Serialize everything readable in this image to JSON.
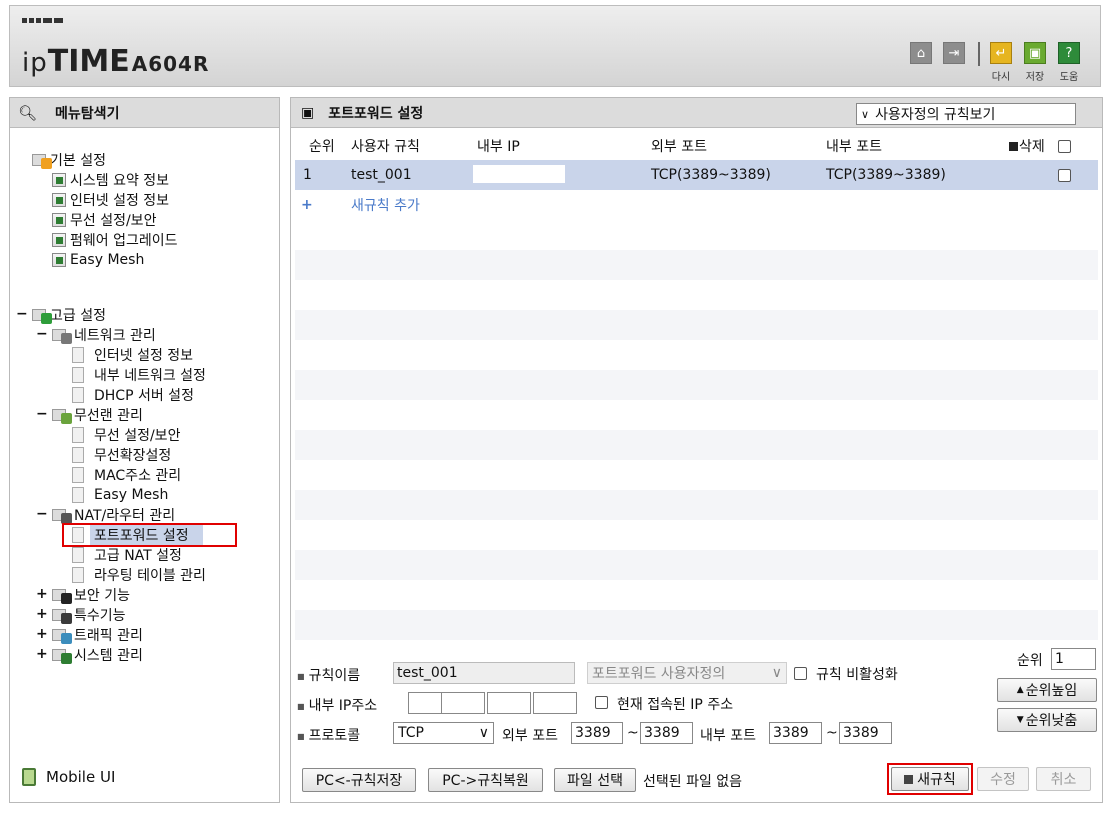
{
  "header": {
    "logo_ip": "ip",
    "logo_time": "TIME",
    "logo_model": "A604R",
    "buttons": [
      {
        "icon": "home-icon"
      },
      {
        "icon": "logout-icon"
      },
      {
        "icon": "refresh-icon",
        "label": "다시"
      },
      {
        "icon": "save-icon",
        "label": "저장"
      },
      {
        "icon": "help-icon",
        "label": "도움"
      }
    ]
  },
  "sidebar": {
    "title": "메뉴탐색기",
    "basic": {
      "label": "기본 설정",
      "items": [
        "시스템 요약 정보",
        "인터넷 설정 정보",
        "무선 설정/보안",
        "펌웨어 업그레이드",
        "Easy Mesh"
      ]
    },
    "advanced": {
      "label": "고급 설정",
      "network": {
        "label": "네트워크 관리",
        "items": [
          "인터넷 설정 정보",
          "내부 네트워크 설정",
          "DHCP 서버 설정"
        ]
      },
      "wireless": {
        "label": "무선랜 관리",
        "items": [
          "무선 설정/보안",
          "무선확장설정",
          "MAC주소 관리",
          "Easy Mesh"
        ]
      },
      "nat": {
        "label": "NAT/라우터 관리",
        "items": [
          "포트포워드 설정",
          "고급 NAT 설정",
          "라우팅 테이블 관리"
        ]
      },
      "collapsed": [
        "보안 기능",
        "특수기능",
        "트래픽 관리",
        "시스템 관리"
      ]
    },
    "mobile_ui": "Mobile UI"
  },
  "main": {
    "title": "포트포워드 설정",
    "view_select": "사용자정의 규칙보기",
    "columns": {
      "rank": "순위",
      "rule": "사용자 규칙",
      "internal_ip": "내부 IP",
      "external_port": "외부 포트",
      "internal_port": "내부 포트",
      "delete": "삭제"
    },
    "rows": [
      {
        "rank": "1",
        "rule": "test_001",
        "internal_ip": "",
        "external_port": "TCP(3389~3389)",
        "internal_port": "TCP(3389~3389)"
      }
    ],
    "add_rule": "새규칙 추가"
  },
  "form": {
    "rule_name_label": "규칙이름",
    "rule_name_value": "test_001",
    "preset_select": "포트포워드 사용자정의",
    "disable_label": "규칙 비활성화",
    "rank_label": "순위",
    "rank_value": "1",
    "internal_ip_label": "내부 IP주소",
    "current_ip_label": "현재 접속된 IP 주소",
    "rank_up": "순위높임",
    "rank_down": "순위낮춤",
    "protocol_label": "프로토콜",
    "protocol_value": "TCP",
    "external_port_label": "외부 포트",
    "external_port_from": "3389",
    "external_port_to": "3389",
    "internal_port_label": "내부 포트",
    "internal_port_from": "3389",
    "internal_port_to": "3389",
    "tilde": "~",
    "pc_save": "PC<-규칙저장",
    "pc_restore": "PC->규칙복원",
    "file_select": "파일 선택",
    "file_status": "선택된 파일 없음",
    "new_rule": "새규칙",
    "modify": "수정",
    "cancel": "취소"
  }
}
